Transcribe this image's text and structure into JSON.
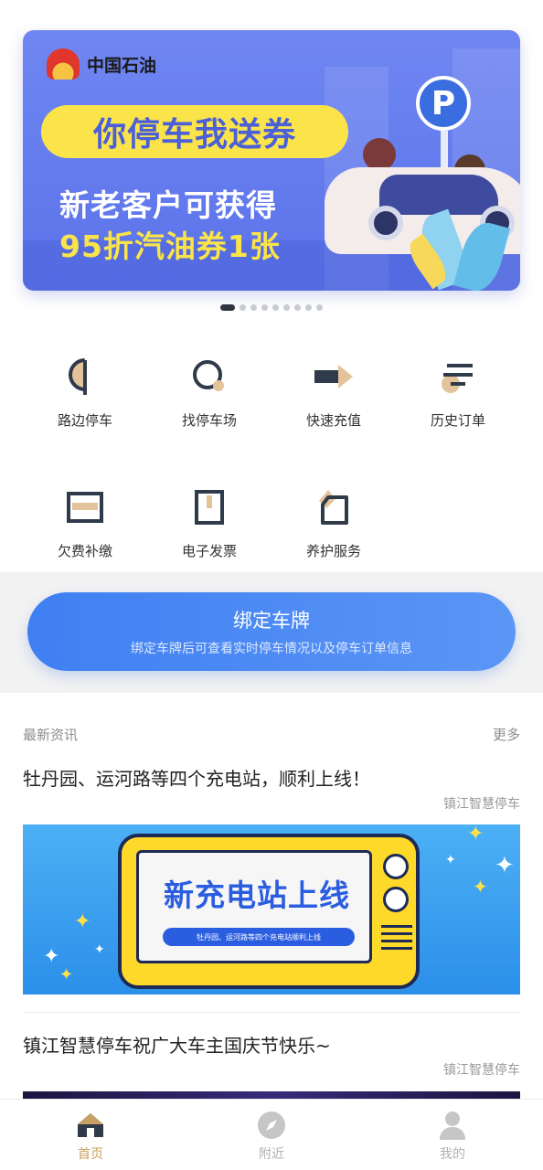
{
  "banner": {
    "brand_name": "中国石油",
    "slogan": "你停车我送券",
    "promo_line1": "新老客户可获得",
    "promo_line2": "95折汽油券1张",
    "parking_sign": "P",
    "dots_total": 9,
    "dots_active_index": 0
  },
  "services": [
    {
      "label": "路边停车",
      "icon": "roadside-parking-icon"
    },
    {
      "label": "找停车场",
      "icon": "find-parking-icon"
    },
    {
      "label": "快速充值",
      "icon": "quick-recharge-icon"
    },
    {
      "label": "历史订单",
      "icon": "order-history-icon"
    },
    {
      "label": "欠费补缴",
      "icon": "arrears-payment-icon"
    },
    {
      "label": "电子发票",
      "icon": "e-invoice-icon"
    },
    {
      "label": "养护服务",
      "icon": "maintenance-service-icon"
    }
  ],
  "bind_plate": {
    "title": "绑定车牌",
    "subtitle": "绑定车牌后可查看实时停车情况以及停车订单信息"
  },
  "news": {
    "section_title": "最新资讯",
    "more_label": "更多",
    "items": [
      {
        "title": "牡丹园、运河路等四个充电站，顺利上线！",
        "source": "镇江智慧停车",
        "image_title": "新充电站上线",
        "image_subtitle": "牡丹园、运河路等四个充电站顺利上线"
      },
      {
        "title": "镇江智慧停车祝广大车主国庆节快乐~",
        "source": "镇江智慧停车"
      }
    ]
  },
  "tabbar": {
    "items": [
      {
        "label": "首页",
        "icon": "home-icon",
        "active": true
      },
      {
        "label": "附近",
        "icon": "compass-icon",
        "active": false
      },
      {
        "label": "我的",
        "icon": "user-icon",
        "active": false
      }
    ]
  },
  "colors": {
    "accent_gold": "#c9a063",
    "icon_dark": "#2f3a4a",
    "bind_blue": "#4a8af4"
  }
}
